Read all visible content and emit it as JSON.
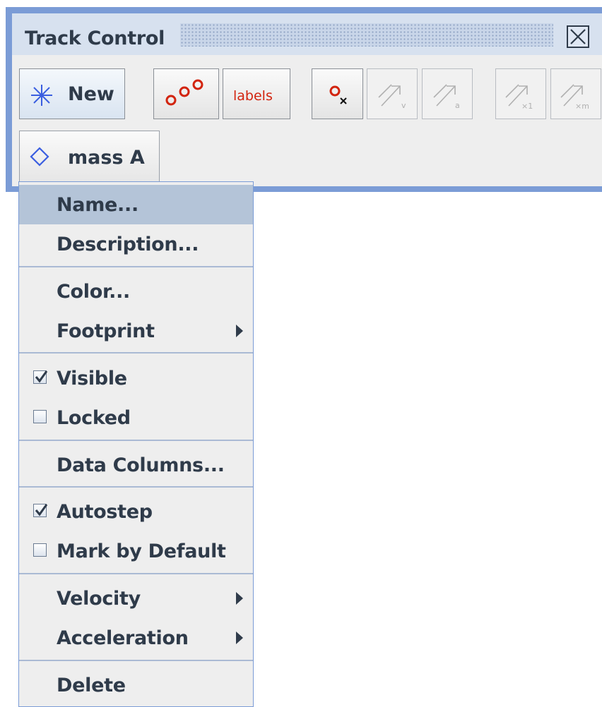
{
  "track_control": {
    "title": "Track Control",
    "new_button_label": "New",
    "labels_button_label": "labels",
    "track_button_label": "mass A"
  },
  "menu": {
    "items": {
      "name": "Name...",
      "description": "Description...",
      "color": "Color...",
      "footprint": "Footprint",
      "visible": "Visible",
      "locked": "Locked",
      "data_columns": "Data Columns...",
      "autostep": "Autostep",
      "mark_by_default": "Mark by Default",
      "velocity": "Velocity",
      "acceleration": "Acceleration",
      "delete": "Delete"
    },
    "checked": {
      "visible": true,
      "locked": false,
      "autostep": true,
      "mark_by_default": false
    }
  },
  "colors": {
    "accent": "#7b9cd6",
    "highlight": "#b4c4d8",
    "text": "#2f3b4a",
    "red_icon": "#d2240f"
  },
  "icons": {
    "new": "asterisk-icon",
    "trail": "trail-circles-icon",
    "position": "position-marker-icon",
    "velocity": "velocity-vector-icon",
    "acceleration": "acceleration-vector-icon",
    "force1": "force-x1-icon",
    "forcem": "force-xm-icon",
    "track": "diamond-icon"
  }
}
